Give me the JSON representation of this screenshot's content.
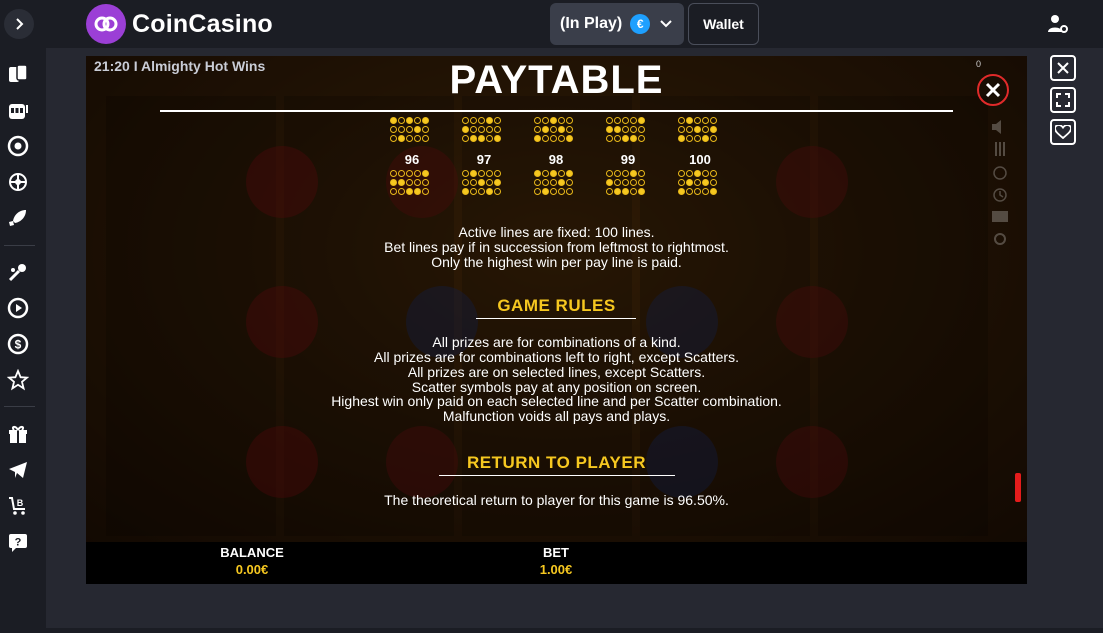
{
  "topbar": {
    "brand": "CoinCasino",
    "play_mode": "(In Play)",
    "currency_symbol": "€",
    "wallet_label": "Wallet"
  },
  "sidebar": {
    "icons": [
      "cards-icon",
      "slot-machine-icon",
      "roulette-icon",
      "live-casino-icon",
      "rocket-icon",
      "sports-icon",
      "play-icon",
      "dollar-icon",
      "star-icon",
      "gift-icon",
      "telegram-icon",
      "bitcoin-cart-icon",
      "help-icon"
    ]
  },
  "game": {
    "label": "21:20 I Almighty Hot Wins",
    "paytable_title": "PAYTABLE",
    "corner_counter": "0",
    "line_numbers": [
      "96",
      "97",
      "98",
      "99",
      "100"
    ],
    "lines_info": [
      "Active lines are fixed: 100 lines.",
      "Bet lines pay if in succession from leftmost to rightmost.",
      "Only the highest win per pay line is paid."
    ],
    "rules_title": "GAME RULES",
    "rules": [
      "All prizes are for combinations of a kind.",
      "All prizes are for combinations left to right, except Scatters.",
      "All prizes are on selected lines, except Scatters.",
      "Scatter symbols pay at any position on screen.",
      "Highest win only paid on each selected line and per Scatter combination.",
      "Malfunction voids all pays and plays."
    ],
    "rtp_title": "RETURN TO PLAYER",
    "rtp_text": "The theoretical return to player for this game is 96.50%.",
    "balance_label": "BALANCE",
    "balance_value": "0.00€",
    "bet_label": "BET",
    "bet_value": "1.00€"
  },
  "colors": {
    "accent_gold": "#f6c820",
    "close_red": "#e02a2a",
    "brand_purple": "#9b3fd6",
    "euro_blue": "#1ea0ff"
  }
}
